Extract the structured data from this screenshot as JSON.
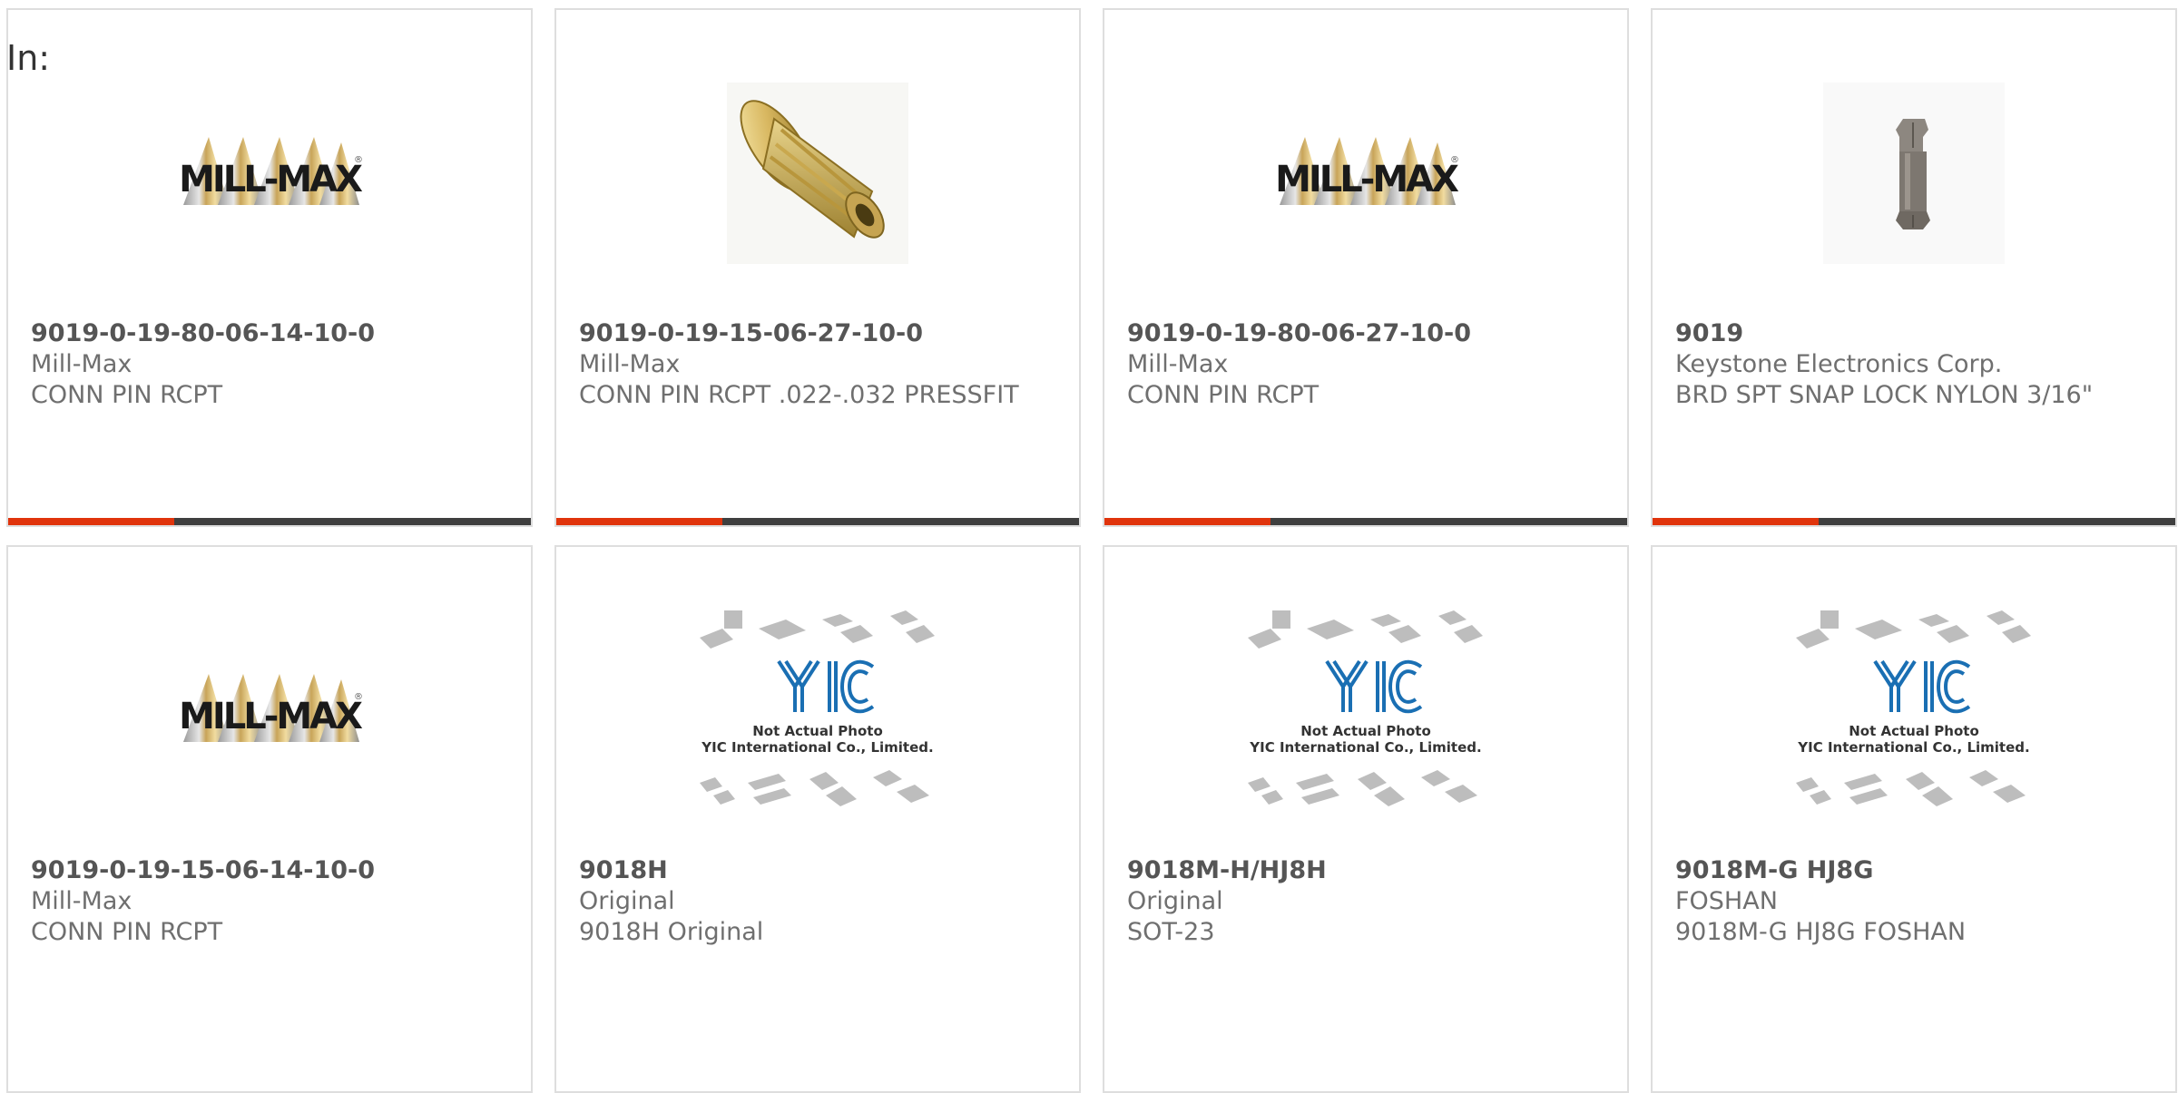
{
  "page": {
    "in_label": "In:"
  },
  "brand_colors": {
    "accent": "#e0340c",
    "bar": "#3f3f3f",
    "card_border": "#dedede"
  },
  "logos": {
    "millmax_text": "MILL-MAX",
    "yic_caption_line1": "Not Actual Photo",
    "yic_caption_line2": "YIC International Co., Limited."
  },
  "products": [
    {
      "part": "9019-0-19-80-06-14-10-0",
      "maker": "Mill-Max",
      "desc": "CONN PIN RCPT",
      "image": "millmax-logo"
    },
    {
      "part": "9019-0-19-15-06-27-10-0",
      "maker": "Mill-Max",
      "desc": "CONN PIN RCPT .022-.032 PRESSFIT",
      "image": "gold-pin-receptacle"
    },
    {
      "part": "9019-0-19-80-06-27-10-0",
      "maker": "Mill-Max",
      "desc": "CONN PIN RCPT",
      "image": "millmax-logo"
    },
    {
      "part": "9019",
      "maker": "Keystone Electronics Corp.",
      "desc": "BRD SPT SNAP LOCK NYLON 3/16\"",
      "image": "nylon-snap-lock"
    },
    {
      "part": "9019-0-19-15-06-14-10-0",
      "maker": "Mill-Max",
      "desc": "CONN PIN RCPT",
      "image": "millmax-logo"
    },
    {
      "part": "9018H",
      "maker": "Original",
      "desc": "9018H Original",
      "image": "yic-placeholder"
    },
    {
      "part": "9018M-H/HJ8H",
      "maker": "Original",
      "desc": "SOT-23",
      "image": "yic-placeholder"
    },
    {
      "part": "9018M-G HJ8G",
      "maker": "FOSHAN",
      "desc": "9018M-G HJ8G FOSHAN",
      "image": "yic-placeholder"
    }
  ]
}
